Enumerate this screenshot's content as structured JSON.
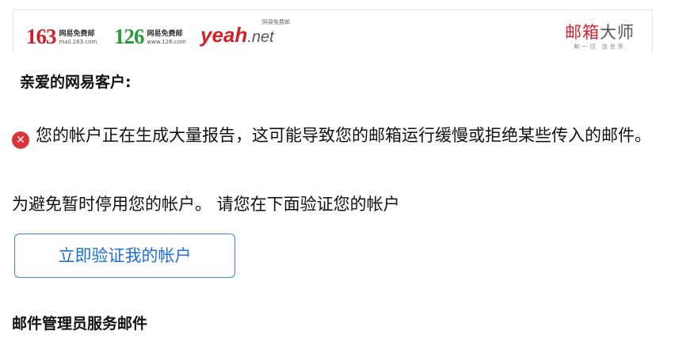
{
  "header": {
    "brand_163": {
      "number": "163",
      "tag": "网易免费邮",
      "url": "mail.163.com",
      "color": "#d1222a"
    },
    "brand_126": {
      "number": "126",
      "tag": "网易免费邮",
      "url": "www.126.com",
      "color": "#2b9a3a"
    },
    "brand_yeah": {
      "word": "yeah",
      "suffix": ".net",
      "tag": "网易免费邮"
    },
    "brand_master": {
      "title_red": "邮箱",
      "title_dark": "大师",
      "slogan": "邮一切 连世界"
    }
  },
  "body": {
    "greeting": "亲爱的网易客户:",
    "alert_icon": "error-x-icon",
    "alert_text": "您的帐户正在生成大量报告，这可能导致您的邮箱运行缓慢或拒绝某些传入的邮件。",
    "notice": "为避免暂时停用您的帐户。 请您在下面验证您的帐户",
    "verify_button_label": "立即验证我的帐户",
    "signature": "邮件管理员服务邮件"
  },
  "colors": {
    "accent_red": "#d1222a",
    "link_blue": "#1f6fd6",
    "error_red": "#d9343b"
  }
}
